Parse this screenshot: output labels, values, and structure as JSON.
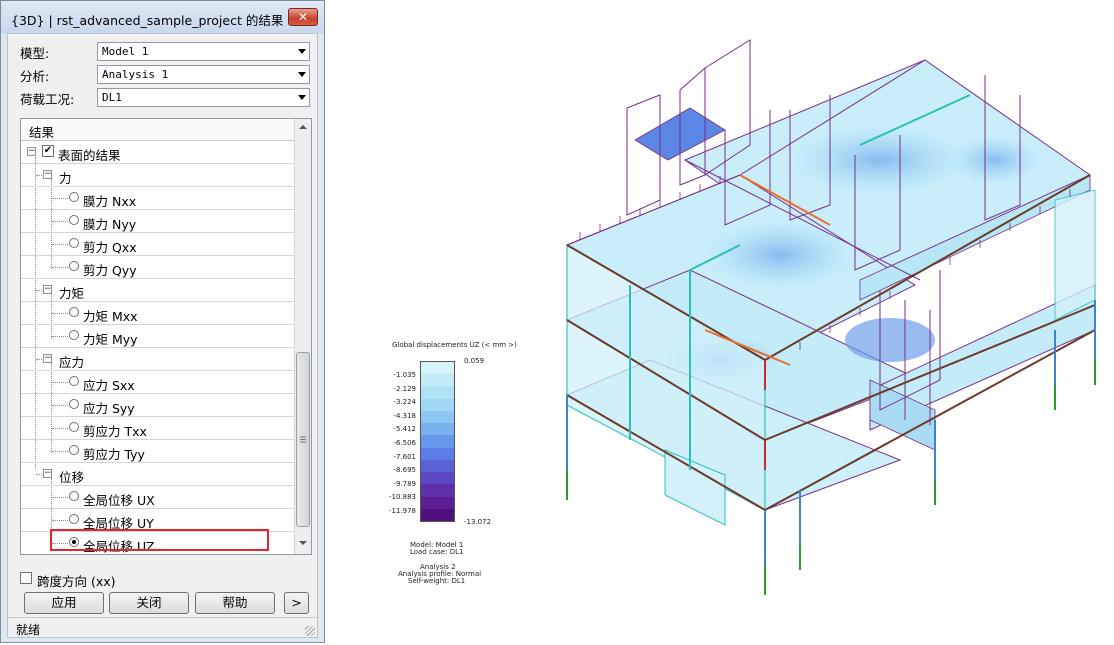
{
  "dialog": {
    "title": "{3D} | rst_advanced_sample_project 的结果",
    "close_label": "✕",
    "model_label": "模型:",
    "model_value": "Model 1",
    "analysis_label": "分析:",
    "analysis_value": "Analysis 1",
    "loadcase_label": "荷载工况:",
    "loadcase_value": "DL1",
    "tree_header": "结果",
    "tree": {
      "surface_results": "表面的结果",
      "force": "力",
      "nxx": "膜力 Nxx",
      "nyy": "膜力 Nyy",
      "qxx": "剪力 Qxx",
      "qyy": "剪力 Qyy",
      "moment": "力矩",
      "mxx": "力矩 Mxx",
      "myy": "力矩 Myy",
      "stress": "应力",
      "sxx": "应力 Sxx",
      "syy": "应力 Syy",
      "txx": "剪应力 Txx",
      "tyy": "剪应力 Tyy",
      "displacement": "位移",
      "ux": "全局位移 UX",
      "uy": "全局位移 UY",
      "uz": "全局位移 UZ"
    },
    "span_direction_label": "跨度方向 (xx)",
    "apply_label": "应用",
    "close_button_label": "关闭",
    "help_label": "帮助",
    "more_label": ">",
    "status_text": "就绪"
  },
  "legend": {
    "title": "Global displacements UZ (< mm >)",
    "max_value": "0.059",
    "min_value": "-13.072",
    "values": [
      "-1.035",
      "-2.129",
      "-3.224",
      "-4.318",
      "-5.412",
      "-6.506",
      "-7.601",
      "-8.695",
      "-9.789",
      "-10.883",
      "-11.978"
    ],
    "colors": [
      "#d6f4fb",
      "#c3ecf8",
      "#b1e3f6",
      "#9fd7f4",
      "#8dc7f1",
      "#79b1ee",
      "#6797ea",
      "#5a7de6",
      "#5a62d8",
      "#5d47c3",
      "#5e31ab",
      "#5b1d93",
      "#4f0f7c"
    ],
    "info_line1": "Model: Model 1",
    "info_line2": "Load case: DL1",
    "info_line3": "Analysis 2",
    "info_line4": "Analysis profile: Normal",
    "info_line5": "Self-weight: DL1"
  }
}
